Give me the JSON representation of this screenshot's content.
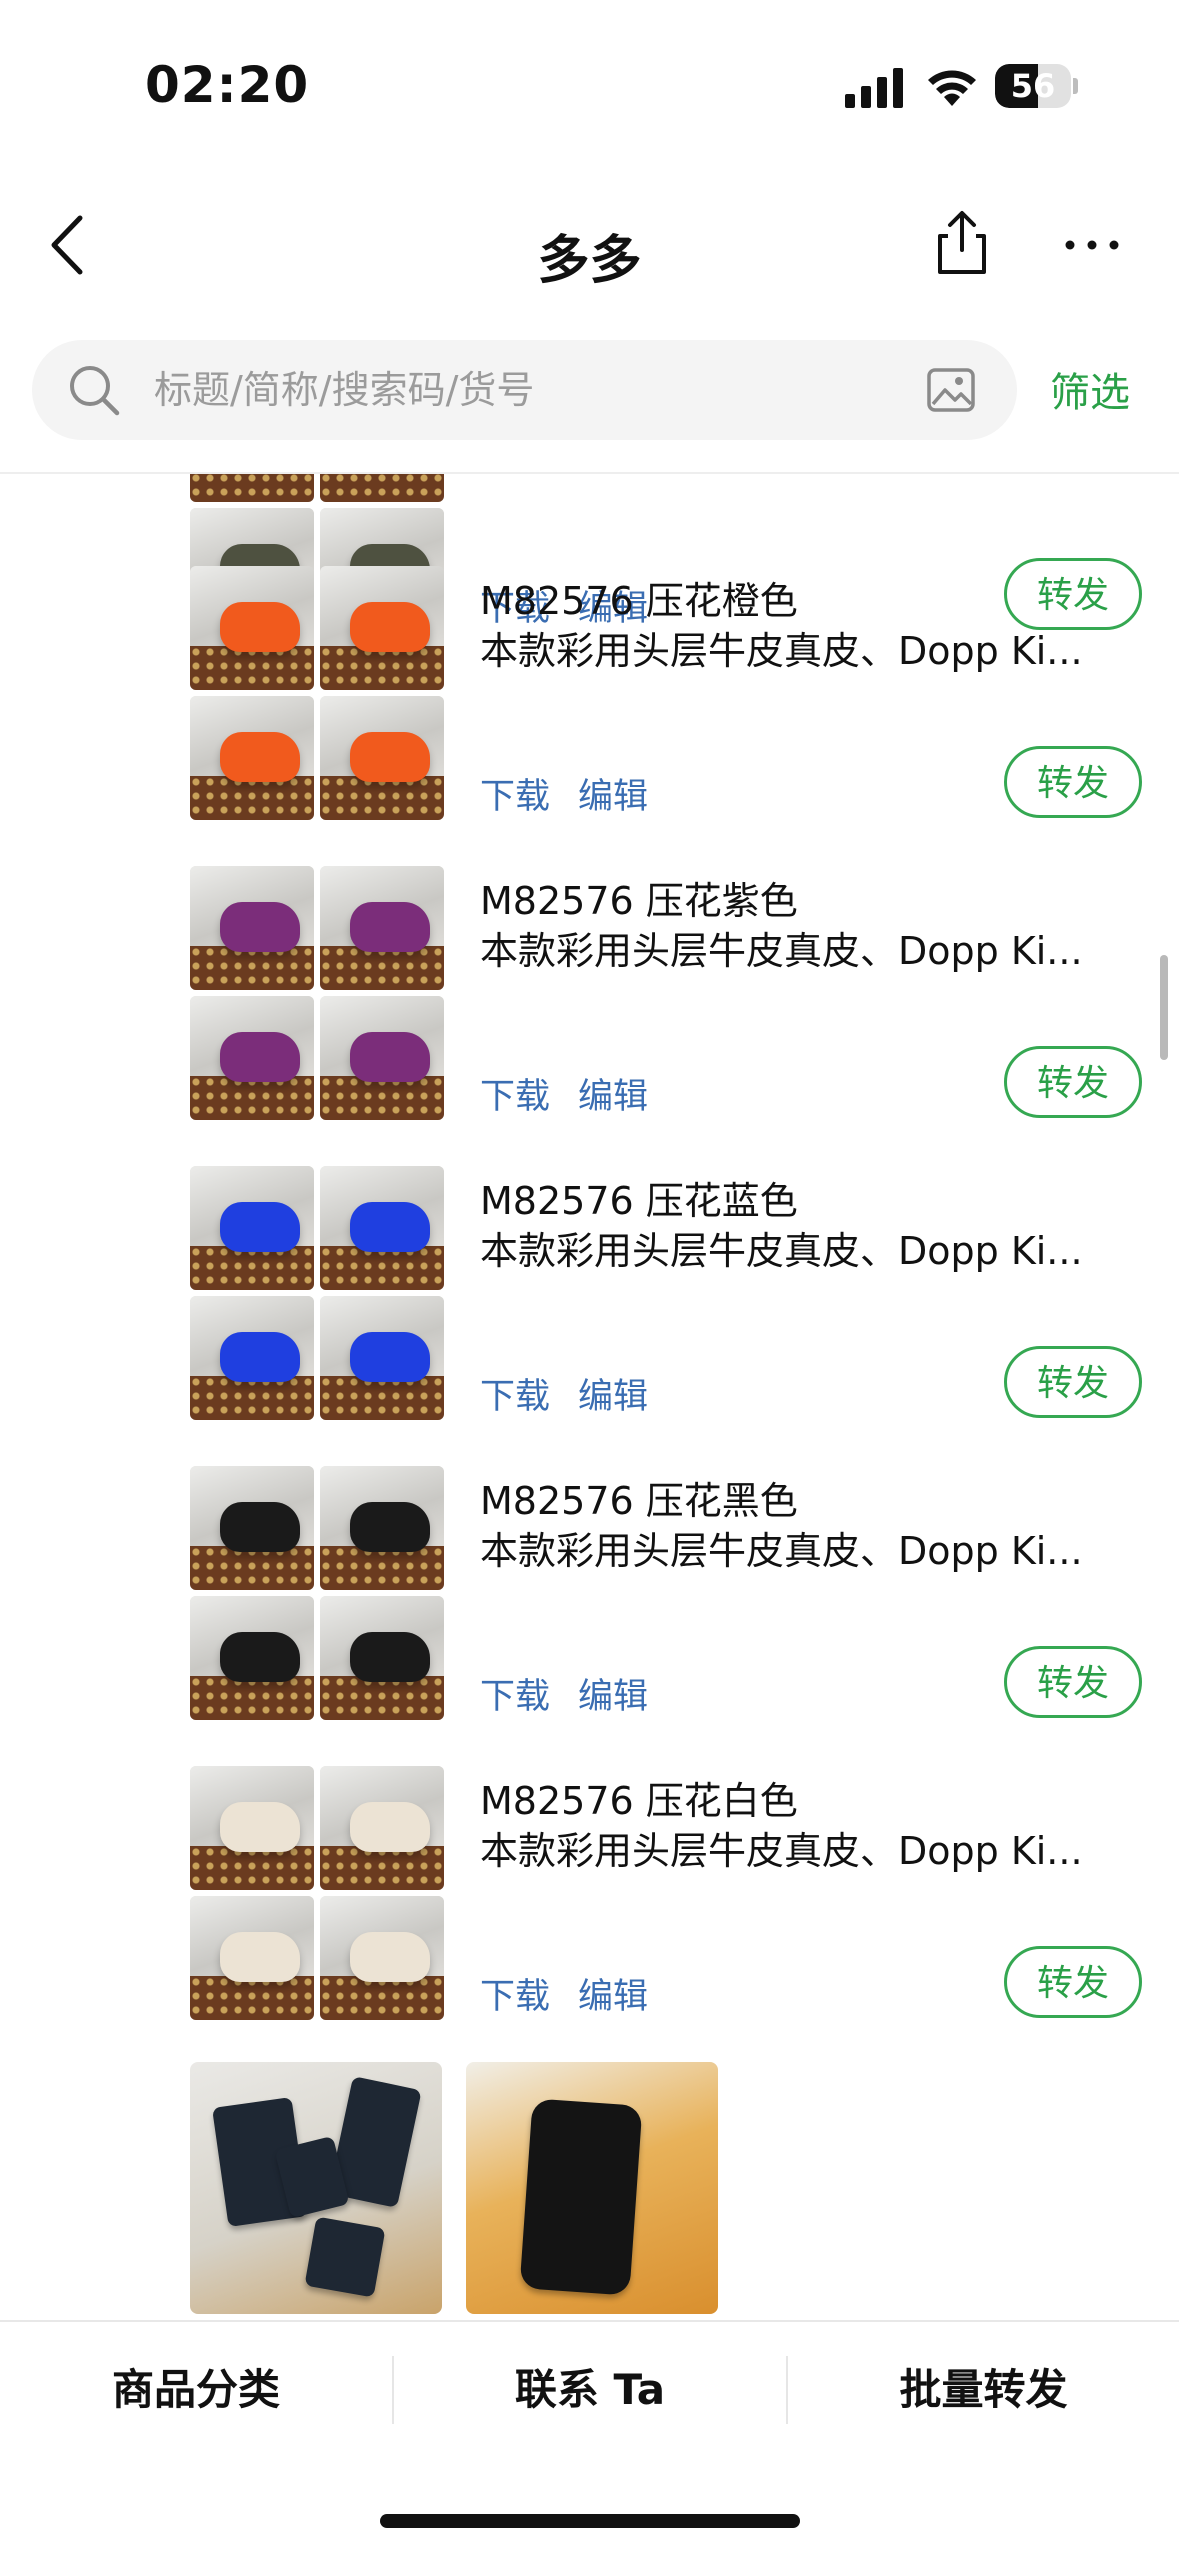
{
  "status_bar": {
    "time": "02:20",
    "battery": "56",
    "battery_level": 0.56
  },
  "nav": {
    "title": "多多"
  },
  "search": {
    "placeholder": "标题/简称/搜索码/货号",
    "filter_label": "筛选"
  },
  "actions": {
    "download": "下载",
    "edit": "编辑",
    "forward": "转发"
  },
  "items": [
    {
      "title": "",
      "description": "",
      "bag_color": "#4e5140"
    },
    {
      "title": "M82576 压花橙色",
      "description": "本款彩用头层牛皮真皮、Dopp Ki...",
      "bag_color": "#f15a1d"
    },
    {
      "title": "M82576 压花紫色",
      "description": "本款彩用头层牛皮真皮、Dopp Ki...",
      "bag_color": "#7b2d7a"
    },
    {
      "title": "M82576 压花蓝色",
      "description": "本款彩用头层牛皮真皮、Dopp Ki...",
      "bag_color": "#1f3fe0"
    },
    {
      "title": "M82576 压花黑色",
      "description": "本款彩用头层牛皮真皮、Dopp Ki...",
      "bag_color": "#1a1a1a"
    },
    {
      "title": "M82576 压花白色",
      "description": "本款彩用头层牛皮真皮、Dopp Ki...",
      "bag_color": "#ece3d4"
    }
  ],
  "bottom_bar": {
    "tab1": "商品分类",
    "tab2": "联系 Ta",
    "tab3": "批量转发"
  },
  "colors": {
    "accent_green": "#2aa048",
    "link_blue": "#3a6db2"
  }
}
